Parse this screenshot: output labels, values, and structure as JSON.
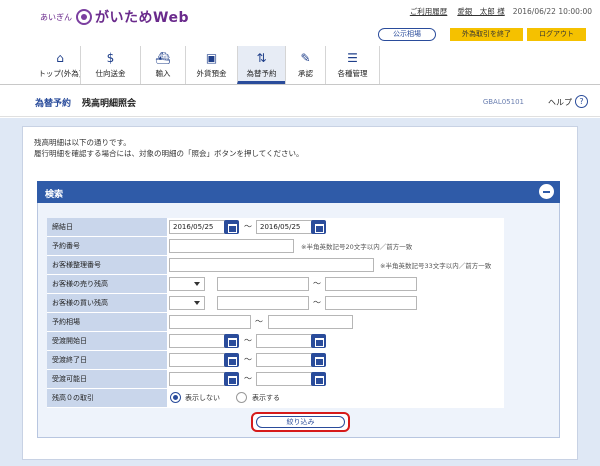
{
  "header": {
    "logo_small": "あいぎん",
    "logo_main": "がいためWeb",
    "links": {
      "login_history": "ご利用履歴",
      "user": "愛銀　太郎 様"
    },
    "datetime": "2016/06/22 10:00:00",
    "rate_button": "公示相場",
    "end_button": "外為取引を終了",
    "logout_button": "ログアウト"
  },
  "nav": {
    "items": [
      {
        "label": "トップ(外為)",
        "icon": "home-icon"
      },
      {
        "label": "仕向送金",
        "icon": "remittance-icon"
      },
      {
        "label": "輸入",
        "icon": "ship-icon"
      },
      {
        "label": "外貨預金",
        "icon": "deposit-icon"
      },
      {
        "label": "為替予約",
        "icon": "exchange-icon"
      },
      {
        "label": "承認",
        "icon": "approval-icon"
      },
      {
        "label": "各種管理",
        "icon": "management-icon"
      }
    ],
    "active_index": 4
  },
  "page": {
    "category": "為替予約",
    "title": "残高明細照会",
    "screen_id": "GBAL05101",
    "help": "ヘルプ"
  },
  "description": {
    "line1": "残高明細は以下の通りです。",
    "line2": "履行明細を確認する場合には、対象の明細の「照会」ボタンを押してください。"
  },
  "search": {
    "title": "検索",
    "rows": {
      "contract_date": {
        "label": "締結日",
        "from": "2016/05/25",
        "to": "2016/05/25"
      },
      "reservation_no": {
        "label": "予約番号",
        "note": "※半角英数記号20文字以内／前方一致"
      },
      "customer_ref": {
        "label": "お客様整理番号",
        "note": "※半角英数記号33文字以内／前方一致"
      },
      "sell_currency": {
        "label": "お客様の売り残高"
      },
      "buy_currency": {
        "label": "お客様の買い残高"
      },
      "rate": {
        "label": "予約相場"
      },
      "delivery_start": {
        "label": "受渡開始日"
      },
      "delivery_end": {
        "label": "受渡終了日"
      },
      "delivery_possible": {
        "label": "受渡可能日"
      },
      "zero_balance": {
        "label": "残高０の取引",
        "option_hide": "表示しない",
        "option_show": "表示する",
        "selected": "表示しない"
      }
    },
    "tilde": "～",
    "filter_button": "絞り込み"
  },
  "colors": {
    "primary": "#2a4c9b",
    "header_bar": "#2f5ba8",
    "label_bg": "#c9d6eb",
    "yellow_button": "#f5c100",
    "highlight": "#d61a1a",
    "logo": "#6a2a8c"
  }
}
